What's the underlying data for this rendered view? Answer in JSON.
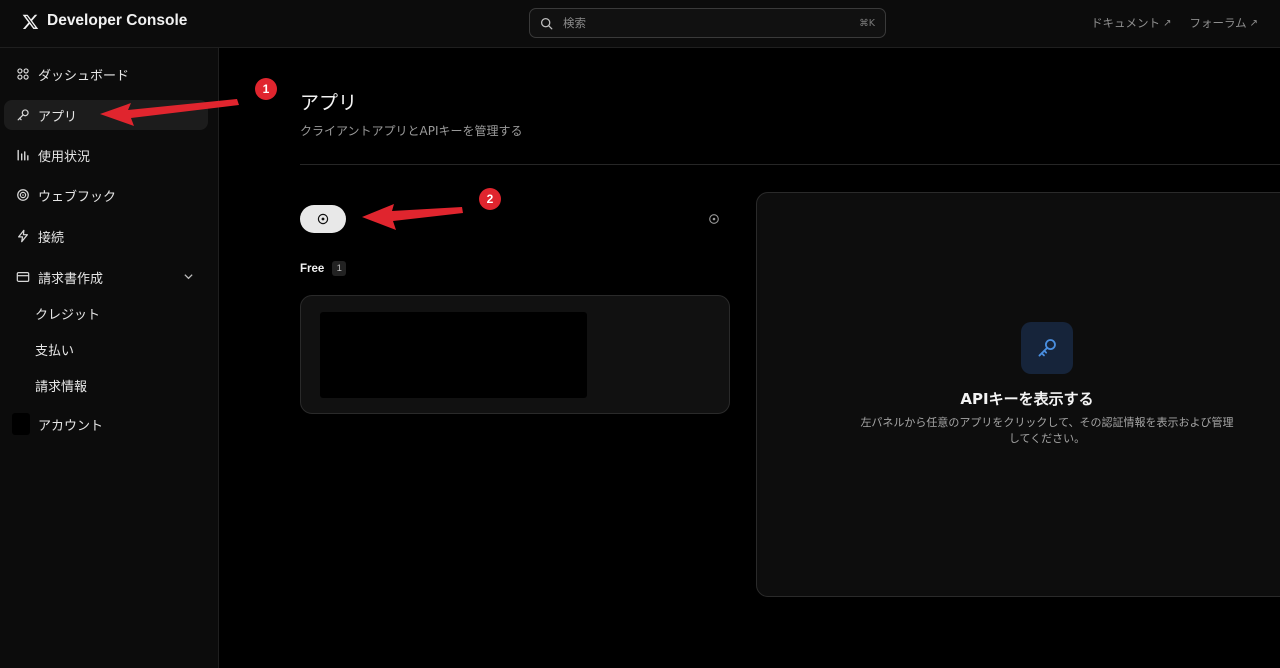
{
  "header": {
    "brand": "Developer Console",
    "search_placeholder": "検索",
    "search_shortcut": "⌘K",
    "links": [
      {
        "label": "ドキュメント",
        "arrow": "↗"
      },
      {
        "label": "フォーラム",
        "arrow": "↗"
      }
    ]
  },
  "sidebar": {
    "items": [
      {
        "label": "ダッシュボード",
        "icon": "grid-icon"
      },
      {
        "label": "アプリ",
        "icon": "key-icon",
        "active": true
      },
      {
        "label": "使用状況",
        "icon": "bar-chart-icon"
      },
      {
        "label": "ウェブフック",
        "icon": "target-icon"
      },
      {
        "label": "接続",
        "icon": "bolt-icon"
      },
      {
        "label": "請求書作成",
        "icon": "credit-card-icon",
        "expanded": true
      }
    ],
    "billing_sub": [
      "クレジット",
      "支払い",
      "請求情報"
    ],
    "account": "アカウント"
  },
  "main": {
    "title": "アプリ",
    "subtitle": "クライアントアプリとAPIキーを管理する",
    "group": {
      "label": "Free",
      "count": "1"
    }
  },
  "detail": {
    "title": "APIキーを表示する",
    "description": "左パネルから任意のアプリをクリックして、その認証情報を表示および管理してください。"
  },
  "annotations": {
    "markers": [
      "1",
      "2"
    ],
    "color": "#e0252e"
  },
  "colors": {
    "background": "#000000",
    "accent_key": "#4a8fe0"
  }
}
